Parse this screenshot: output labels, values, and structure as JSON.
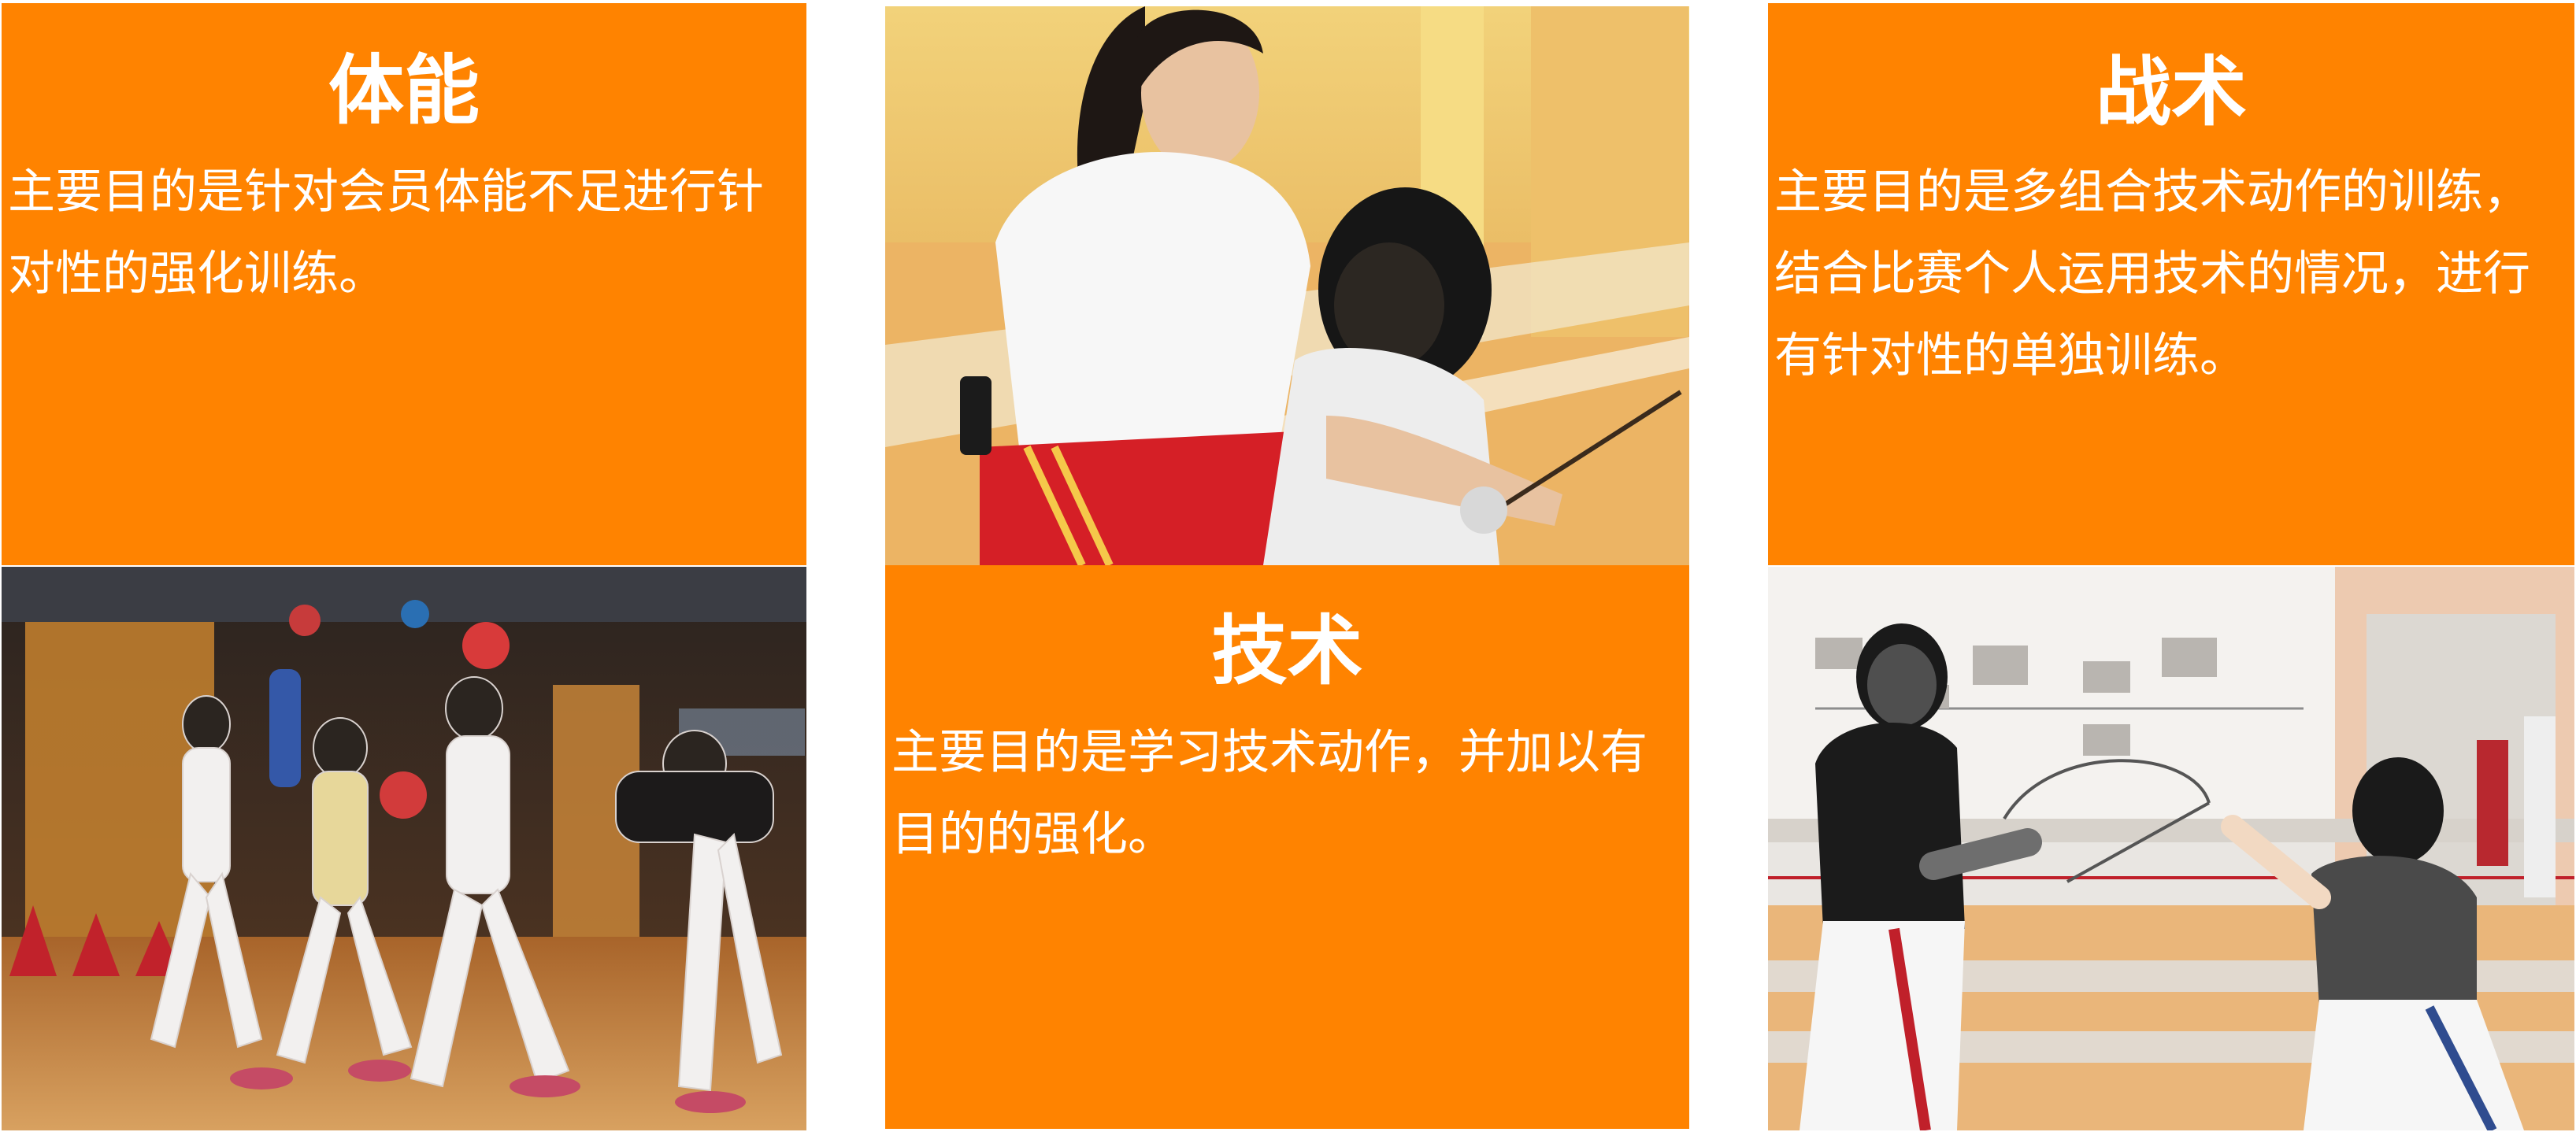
{
  "panels": [
    {
      "title": "体能",
      "description": "主要目的是针对会员体能不足进行针对性的强化训练。"
    },
    {
      "title": "技术",
      "description": "主要目的是学习技术动作，并加以有目的的强化。"
    },
    {
      "title": "战术",
      "description": "主要目的是多组合技术动作的训练，结合比赛个人运用技术的情况，进行有针对性的单独训练。"
    }
  ],
  "photos": [
    {
      "subject": "children doing ball exercises in fencing whites in a gym"
    },
    {
      "subject": "female coach in white polo guiding a masked child fencer"
    },
    {
      "subject": "two masked fencers crossing blades in a training hall"
    }
  ],
  "colors": {
    "panel_orange": "#ff8300",
    "text_white": "#ffffff"
  }
}
